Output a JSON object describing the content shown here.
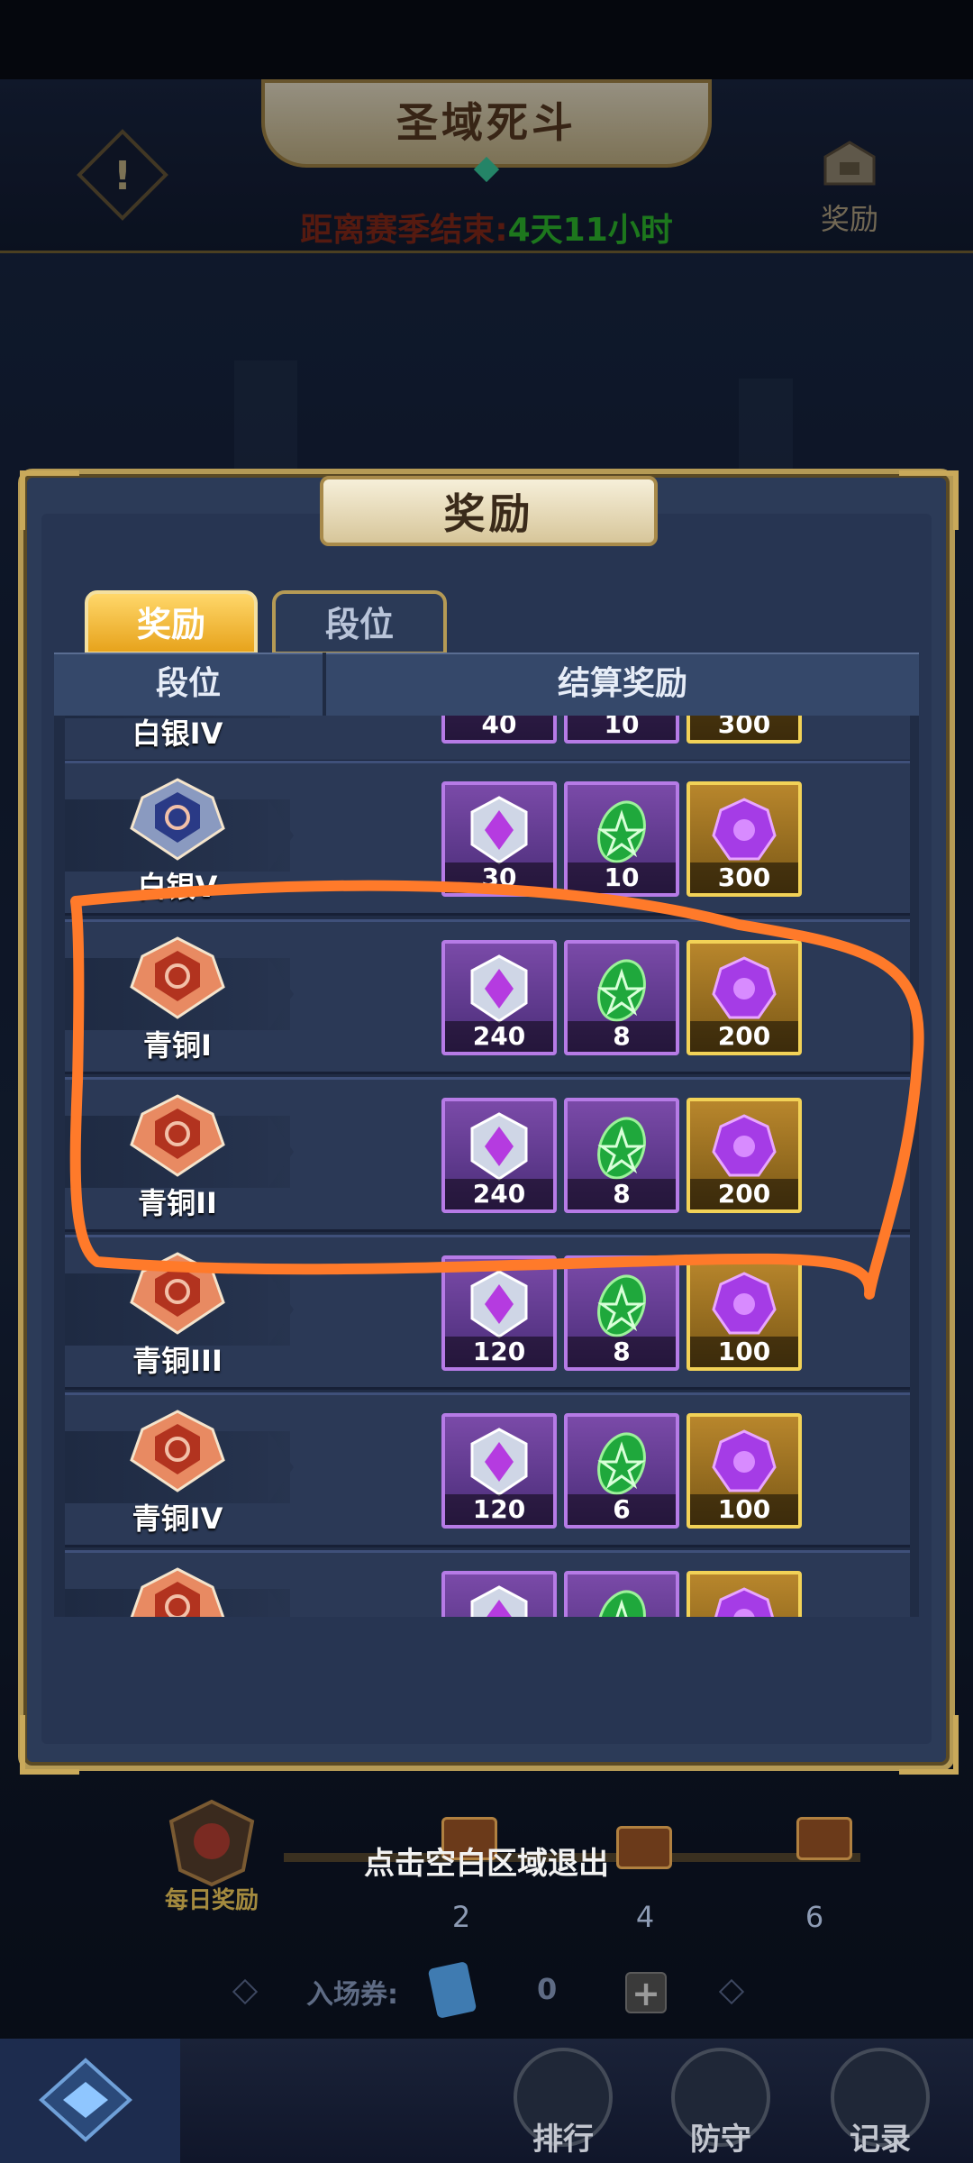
{
  "header": {
    "title": "圣域死斗",
    "season_label": "距离赛季结束:",
    "season_value": "4天11小时",
    "rewards_label": "奖励"
  },
  "modal": {
    "title": "奖励",
    "tabs": [
      {
        "label": "奖励",
        "active": true
      },
      {
        "label": "段位",
        "active": false
      }
    ],
    "columns": [
      "段位",
      "结算奖励"
    ],
    "rows": [
      {
        "rank": "白银IV",
        "rewards": [
          "40",
          "10",
          "300"
        ]
      },
      {
        "rank": "白银V",
        "rewards": [
          "30",
          "10",
          "300"
        ]
      },
      {
        "rank": "青铜I",
        "rewards": [
          "240",
          "8",
          "200"
        ]
      },
      {
        "rank": "青铜II",
        "rewards": [
          "240",
          "8",
          "200"
        ]
      },
      {
        "rank": "青铜III",
        "rewards": [
          "120",
          "8",
          "100"
        ]
      },
      {
        "rank": "青铜IV",
        "rewards": [
          "120",
          "6",
          "100"
        ]
      },
      {
        "rank": "",
        "rewards": [
          "",
          "",
          ""
        ]
      }
    ],
    "reward_icons": [
      "crest-crystal-icon",
      "green-rune-icon",
      "purple-gem-icon"
    ],
    "colors": {
      "highlight_annotation": "#ff7a2a",
      "item_purple": "#b67be6",
      "item_gold": "#f2d257"
    }
  },
  "bottom": {
    "exit_hint": "点击空白区域退出",
    "daily_reward_label": "每日奖励",
    "milestones": [
      "2",
      "4",
      "6"
    ],
    "ticket_label": "入场券:",
    "ticket_value": "0",
    "plus_label": "+"
  },
  "nav": {
    "items": [
      {
        "label": "排行"
      },
      {
        "label": "防守"
      },
      {
        "label": "记录"
      }
    ]
  }
}
